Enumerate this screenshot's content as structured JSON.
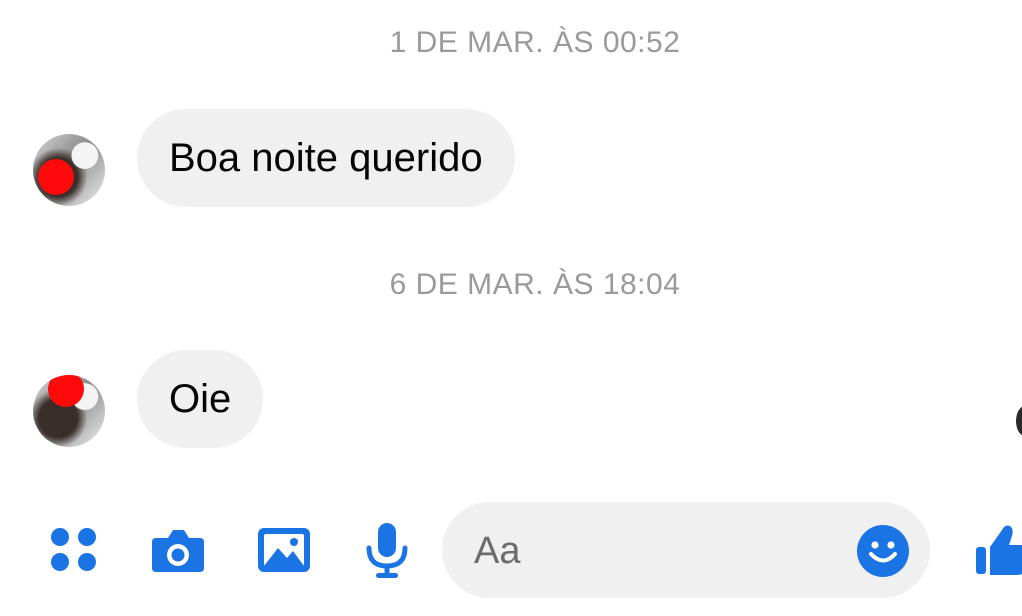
{
  "thread": {
    "messages": [
      {
        "timestamp": "1 DE MAR. ÀS 00:52",
        "text": "Boa noite querido"
      },
      {
        "timestamp": "6 DE MAR. ÀS 18:04",
        "text": "Oie"
      }
    ]
  },
  "composer": {
    "placeholder": "Aa",
    "icons": [
      "apps-icon",
      "camera-icon",
      "image-icon",
      "microphone-icon",
      "emoji-icon",
      "thumbs-up-icon"
    ]
  },
  "colors": {
    "accent": "#1b74e4",
    "bubble": "#f1f0f0",
    "timestamp": "#9a9a9a",
    "text": "#050505",
    "redaction": "#ff0a0a"
  }
}
